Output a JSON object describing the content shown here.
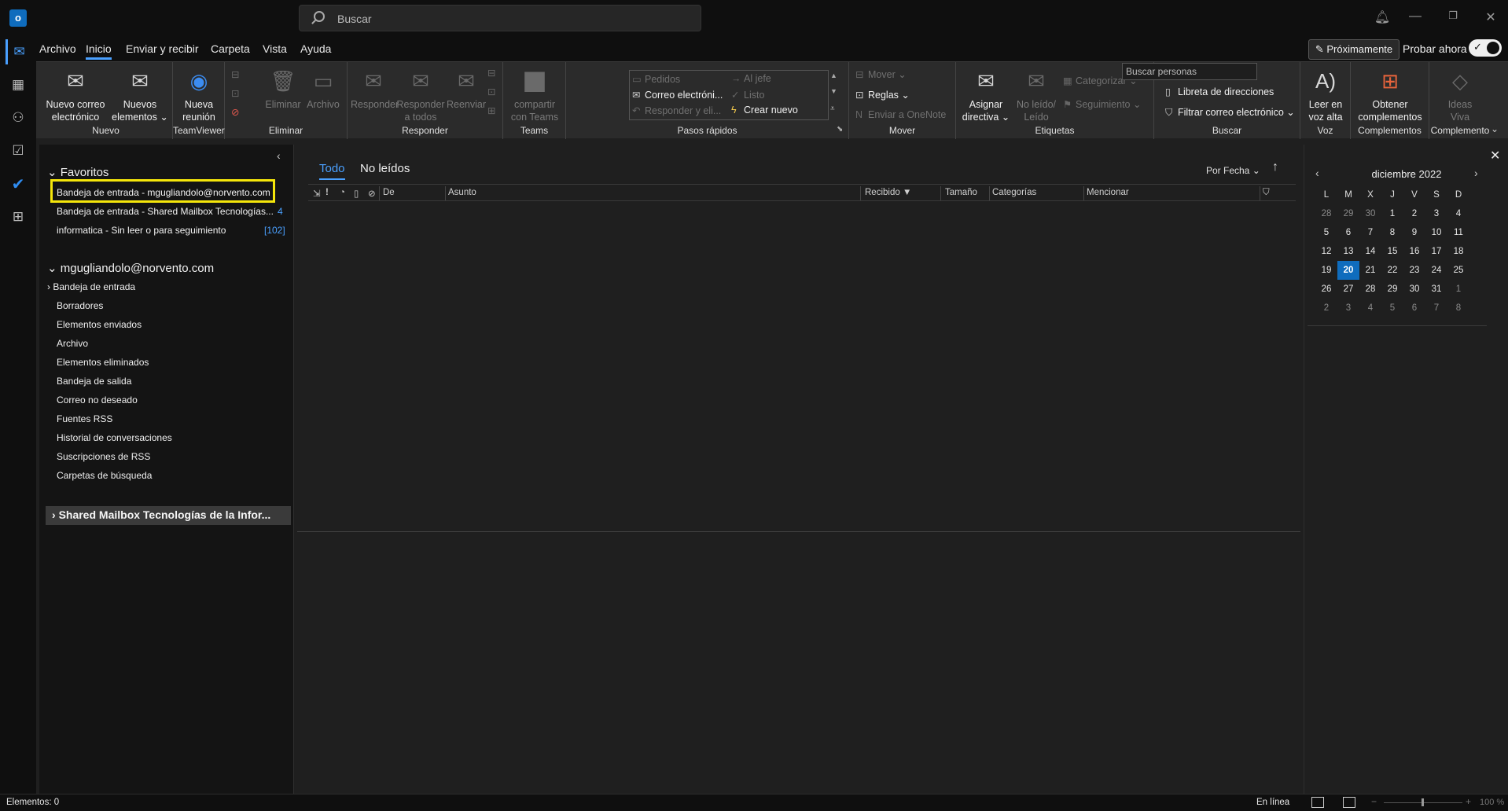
{
  "app": {
    "logo_letter": "o"
  },
  "search": {
    "placeholder": "Buscar"
  },
  "menu": {
    "tabs": [
      "Archivo",
      "Inicio",
      "Enviar y recibir",
      "Carpeta",
      "Vista",
      "Ayuda"
    ],
    "active_tab": "Inicio",
    "coming_soon": "Próximamente",
    "try_now": "Probar ahora"
  },
  "ribbon": {
    "groups": {
      "nuevo": "Nuevo",
      "teamviewer": "TeamViewer",
      "eliminar": "Eliminar",
      "responder": "Responder",
      "teams": "Teams",
      "pasos_rapidos": "Pasos rápidos",
      "mover": "Mover",
      "etiquetas": "Etiquetas",
      "buscar": "Buscar",
      "voz": "Voz",
      "complementos": "Complementos",
      "complemento": "Complemento"
    },
    "buttons": {
      "new_email_1": "Nuevo correo",
      "new_email_2": "electrónico",
      "new_items_1": "Nuevos",
      "new_items_2": "elementos",
      "new_meeting_1": "Nueva",
      "new_meeting_2": "reunión",
      "delete": "Eliminar",
      "archive": "Archivo",
      "reply": "Responder",
      "reply_all_1": "Responder",
      "reply_all_2": "a todos",
      "forward": "Reenviar",
      "share_teams_1": "compartir",
      "share_teams_2": "con Teams",
      "qs_orders": "Pedidos",
      "qs_manager": "Al jefe",
      "qs_email": "Correo electróni...",
      "qs_done": "Listo",
      "qs_reply_delete": "Responder y eli...",
      "qs_create_new": "Crear nuevo",
      "move": "Mover",
      "rules": "Reglas",
      "onenote": "Enviar a OneNote",
      "policy_1": "Asignar",
      "policy_2": "directiva",
      "unread_1": "No leído/",
      "unread_2": "Leído",
      "categorize": "Categorizar",
      "followup": "Seguimiento",
      "search_people": "Buscar personas",
      "address_book": "Libreta de direcciones",
      "filter_email": "Filtrar correo electrónico",
      "read_aloud_1": "Leer en",
      "read_aloud_2": "voz alta",
      "get_addins_1": "Obtener",
      "get_addins_2": "complementos",
      "ideas_1": "Ideas",
      "ideas_2": "Viva"
    }
  },
  "folder_pane": {
    "favorites_title": "Favoritos",
    "favorites": [
      {
        "label": "Bandeja de entrada - mgugliandolo@norvento.com",
        "count": ""
      },
      {
        "label": "Bandeja de entrada - Shared Mailbox Tecnologías...",
        "count": "4"
      },
      {
        "label": "informatica - Sin leer o para seguimiento",
        "count": "[102]"
      }
    ],
    "account_title": "mgugliandolo@norvento.com",
    "folders": [
      "Bandeja de entrada",
      "Borradores",
      "Elementos enviados",
      "Archivo",
      "Elementos eliminados",
      "Bandeja de salida",
      "Correo no deseado",
      "Fuentes RSS",
      "Historial de conversaciones",
      "Suscripciones de RSS",
      "Carpetas de búsqueda"
    ],
    "shared_mailbox": "Shared Mailbox Tecnologías de la Infor..."
  },
  "message_list": {
    "filters": [
      "Todo",
      "No leídos"
    ],
    "active_filter": "Todo",
    "sort_by": "Por Fecha",
    "columns": {
      "from": "De",
      "subject": "Asunto",
      "received": "Recibido",
      "size": "Tamaño",
      "categories": "Categorías",
      "mention": "Mencionar"
    }
  },
  "calendar": {
    "month_title": "diciembre 2022",
    "weekdays": [
      "L",
      "M",
      "X",
      "J",
      "V",
      "S",
      "D"
    ],
    "weeks": [
      [
        "28",
        "29",
        "30",
        "1",
        "2",
        "3",
        "4"
      ],
      [
        "5",
        "6",
        "7",
        "8",
        "9",
        "10",
        "11"
      ],
      [
        "12",
        "13",
        "14",
        "15",
        "16",
        "17",
        "18"
      ],
      [
        "19",
        "20",
        "21",
        "22",
        "23",
        "24",
        "25"
      ],
      [
        "26",
        "27",
        "28",
        "29",
        "30",
        "31",
        "1"
      ],
      [
        "2",
        "3",
        "4",
        "5",
        "6",
        "7",
        "8"
      ]
    ],
    "today": "20"
  },
  "status": {
    "items": "Elementos: 0",
    "online": "En línea",
    "zoom": "100 %"
  },
  "colors": {
    "accent": "#4aa0ff",
    "highlight_box": "#f5e60a",
    "today": "#0f6cbd"
  }
}
